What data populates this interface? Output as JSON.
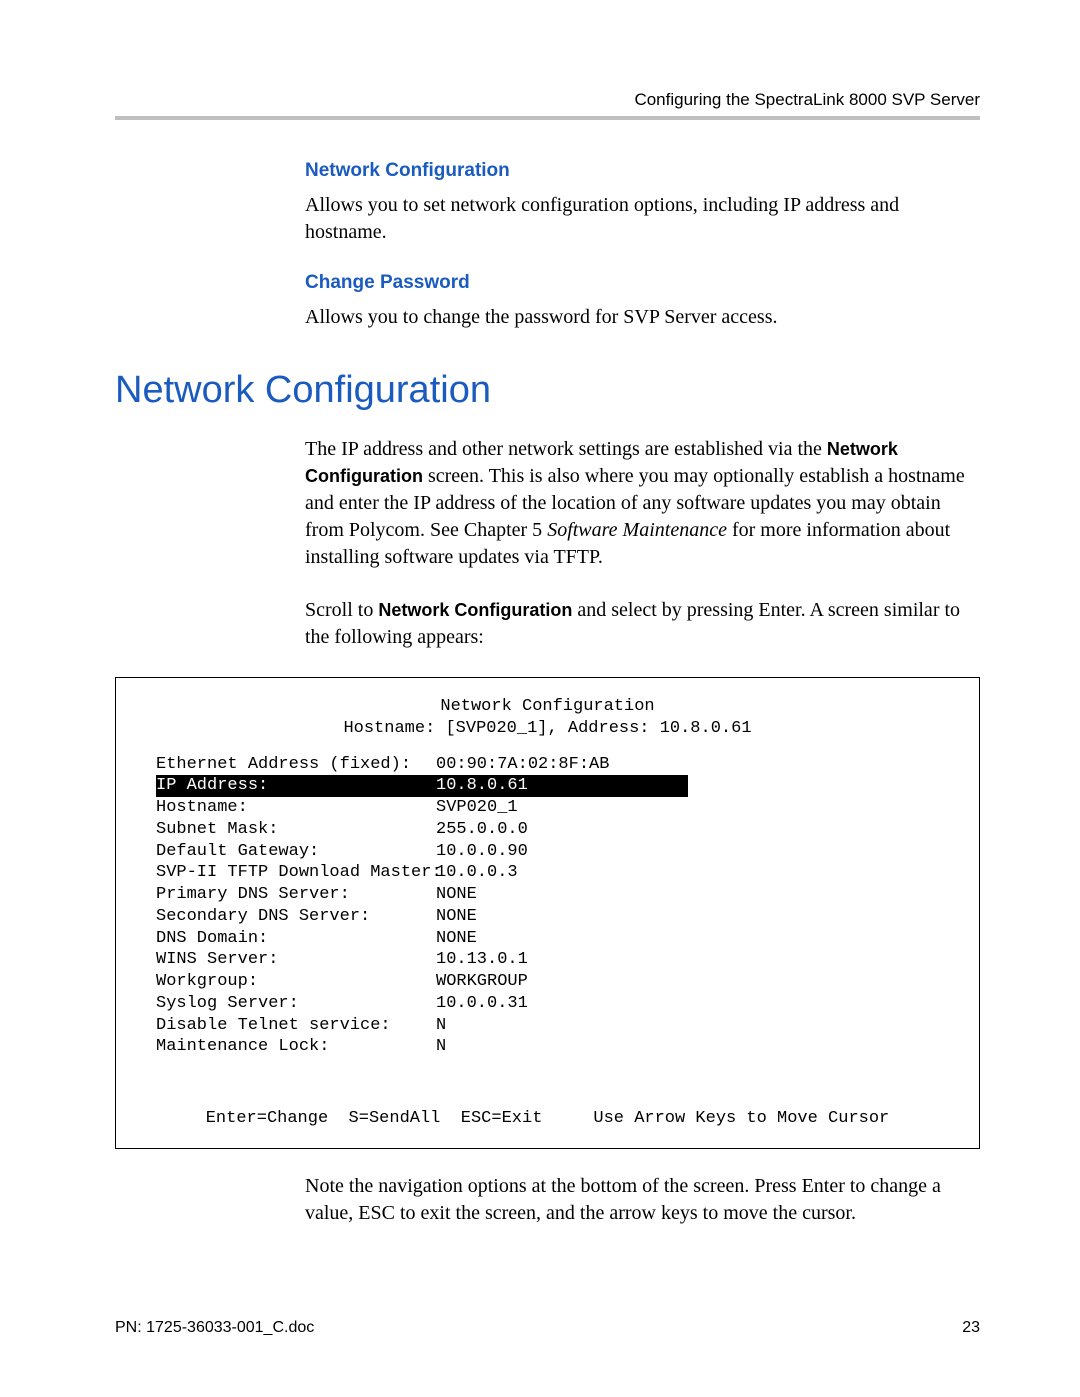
{
  "header": {
    "right_text": "Configuring the SpectraLink 8000 SVP Server"
  },
  "section1": {
    "heading": "Network Configuration",
    "body": "Allows you to set network configuration options, including IP address and hostname."
  },
  "section2": {
    "heading": "Change Password",
    "body": "Allows you to change the password for SVP Server access."
  },
  "main_title": "Network Configuration",
  "para1": {
    "pre": "The IP address and other network settings are established via the ",
    "bold": "Network Configuration",
    "mid": " screen. This is also where you may optionally establish a hostname and enter the IP address of the location of any software updates you may obtain from Polycom. See Chapter 5 ",
    "italic": "Software Maintenance",
    "post": " for more information about installing software updates via TFTP."
  },
  "para2": {
    "pre": "Scroll to ",
    "bold": "Network Configuration",
    "post": " and select by pressing Enter. A screen similar to the following appears:"
  },
  "terminal": {
    "title": "Network Configuration",
    "subtitle": "Hostname: [SVP020_1], Address: 10.8.0.61",
    "rows": [
      {
        "label": "Ethernet Address (fixed):",
        "value": "00:90:7A:02:8F:AB",
        "hl": false
      },
      {
        "label": "IP Address:",
        "value": "10.8.0.61",
        "hl": true
      },
      {
        "label": "Hostname:",
        "value": "SVP020_1",
        "hl": false
      },
      {
        "label": "Subnet Mask:",
        "value": "255.0.0.0",
        "hl": false
      },
      {
        "label": "Default Gateway:",
        "value": "10.0.0.90",
        "hl": false
      },
      {
        "label": "SVP-II TFTP Download Master:",
        "value": "10.0.0.3",
        "hl": false
      },
      {
        "label": "Primary DNS Server:",
        "value": "NONE",
        "hl": false
      },
      {
        "label": "Secondary DNS Server:",
        "value": "NONE",
        "hl": false
      },
      {
        "label": "DNS Domain:",
        "value": "NONE",
        "hl": false
      },
      {
        "label": "WINS Server:",
        "value": "10.13.0.1",
        "hl": false
      },
      {
        "label": "Workgroup:",
        "value": "WORKGROUP",
        "hl": false
      },
      {
        "label": "Syslog Server:",
        "value": "10.0.0.31",
        "hl": false
      },
      {
        "label": "Disable Telnet service:",
        "value": "N",
        "hl": false
      },
      {
        "label": "Maintenance Lock:",
        "value": "N",
        "hl": false
      }
    ],
    "footer": "Enter=Change  S=SendAll  ESC=Exit     Use Arrow Keys to Move Cursor"
  },
  "para3": "Note the navigation options at the bottom of the screen. Press Enter to change a value, ESC to exit the screen, and the arrow keys to move the cursor.",
  "footer": {
    "left": "PN: 1725-36033-001_C.doc",
    "right": "23"
  }
}
